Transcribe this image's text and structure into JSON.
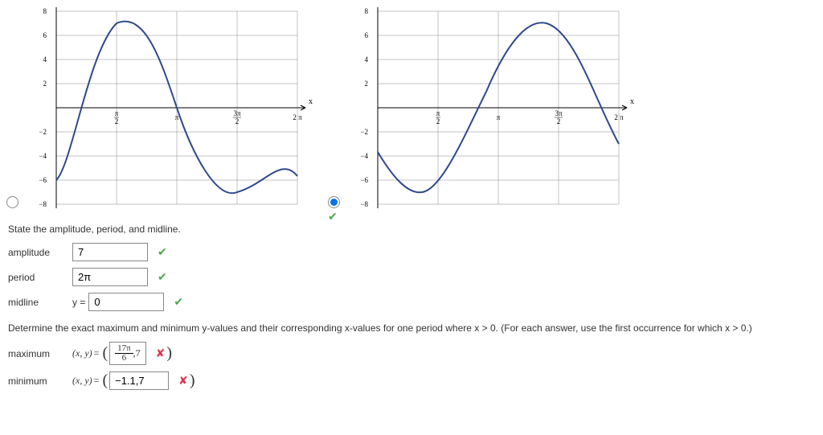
{
  "chart_data": [
    {
      "type": "line",
      "title": "",
      "xlabel": "x",
      "ylabel": "",
      "xlim": [
        0,
        "2π"
      ],
      "ylim": [
        -8,
        8
      ],
      "x_ticks": [
        "π/2",
        "π",
        "3π/2",
        "2π"
      ],
      "y_ticks": [
        -8,
        -6,
        -4,
        -2,
        2,
        4,
        6,
        8
      ],
      "series": [
        {
          "name": "curve",
          "description": "Starts near y≈-6 at x=0, rises to max y≈7 near x≈π/2, falls crossing 0 near x≈π, reaches min y≈-7 near x≈3π/2, rises back toward y≈-6 at x=2π (cosine-like, shifted)."
        }
      ],
      "selected": false
    },
    {
      "type": "line",
      "title": "",
      "xlabel": "x",
      "ylabel": "",
      "xlim": [
        0,
        "2π"
      ],
      "ylim": [
        -8,
        8
      ],
      "x_ticks": [
        "π/2",
        "π",
        "3π/2",
        "2π"
      ],
      "y_ticks": [
        -8,
        -6,
        -4,
        -2,
        2,
        4,
        6,
        8
      ],
      "series": [
        {
          "name": "curve",
          "description": "Starts near y≈-4 at x=0, dips to min y≈-7 near x≈π/3, rises crossing 0 near x≈5π/6, reaches max y≈7 near x≈4π/3, falls back toward y≈-3 at x=2π (sine-like, phase-shifted)."
        }
      ],
      "selected": true
    }
  ],
  "q1": {
    "prompt": "State the amplitude, period, and midline.",
    "rows": {
      "amplitude": {
        "label": "amplitude",
        "value": "7",
        "correct": true
      },
      "period": {
        "label": "period",
        "value": "2π",
        "correct": true
      },
      "midline": {
        "label": "midline",
        "prefix": "y =",
        "value": "0",
        "correct": true
      }
    }
  },
  "q2": {
    "prompt": "Determine the exact maximum and minimum y-values and their corresponding x-values for one period where  x > 0.  (For each answer, use the first occurrence for which  x > 0.)",
    "rows": {
      "max": {
        "label": "maximum",
        "value_html": "frac:17π/6 ,7",
        "value": "17π/6 ,7",
        "correct": false
      },
      "min": {
        "label": "minimum",
        "value": "−1.1,7",
        "correct": false
      }
    }
  },
  "icons": {
    "check": "✔",
    "cross": "✘"
  }
}
